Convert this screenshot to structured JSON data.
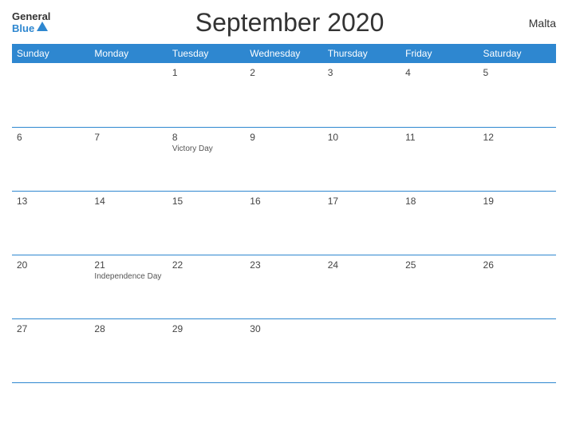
{
  "header": {
    "logo_general": "General",
    "logo_blue": "Blue",
    "title": "September 2020",
    "country": "Malta"
  },
  "days_of_week": [
    "Sunday",
    "Monday",
    "Tuesday",
    "Wednesday",
    "Thursday",
    "Friday",
    "Saturday"
  ],
  "weeks": [
    [
      {
        "day": "",
        "holiday": ""
      },
      {
        "day": "",
        "holiday": ""
      },
      {
        "day": "1",
        "holiday": ""
      },
      {
        "day": "2",
        "holiday": ""
      },
      {
        "day": "3",
        "holiday": ""
      },
      {
        "day": "4",
        "holiday": ""
      },
      {
        "day": "5",
        "holiday": ""
      }
    ],
    [
      {
        "day": "6",
        "holiday": ""
      },
      {
        "day": "7",
        "holiday": ""
      },
      {
        "day": "8",
        "holiday": "Victory Day"
      },
      {
        "day": "9",
        "holiday": ""
      },
      {
        "day": "10",
        "holiday": ""
      },
      {
        "day": "11",
        "holiday": ""
      },
      {
        "day": "12",
        "holiday": ""
      }
    ],
    [
      {
        "day": "13",
        "holiday": ""
      },
      {
        "day": "14",
        "holiday": ""
      },
      {
        "day": "15",
        "holiday": ""
      },
      {
        "day": "16",
        "holiday": ""
      },
      {
        "day": "17",
        "holiday": ""
      },
      {
        "day": "18",
        "holiday": ""
      },
      {
        "day": "19",
        "holiday": ""
      }
    ],
    [
      {
        "day": "20",
        "holiday": ""
      },
      {
        "day": "21",
        "holiday": "Independence Day"
      },
      {
        "day": "22",
        "holiday": ""
      },
      {
        "day": "23",
        "holiday": ""
      },
      {
        "day": "24",
        "holiday": ""
      },
      {
        "day": "25",
        "holiday": ""
      },
      {
        "day": "26",
        "holiday": ""
      }
    ],
    [
      {
        "day": "27",
        "holiday": ""
      },
      {
        "day": "28",
        "holiday": ""
      },
      {
        "day": "29",
        "holiday": ""
      },
      {
        "day": "30",
        "holiday": ""
      },
      {
        "day": "",
        "holiday": ""
      },
      {
        "day": "",
        "holiday": ""
      },
      {
        "day": "",
        "holiday": ""
      }
    ]
  ]
}
